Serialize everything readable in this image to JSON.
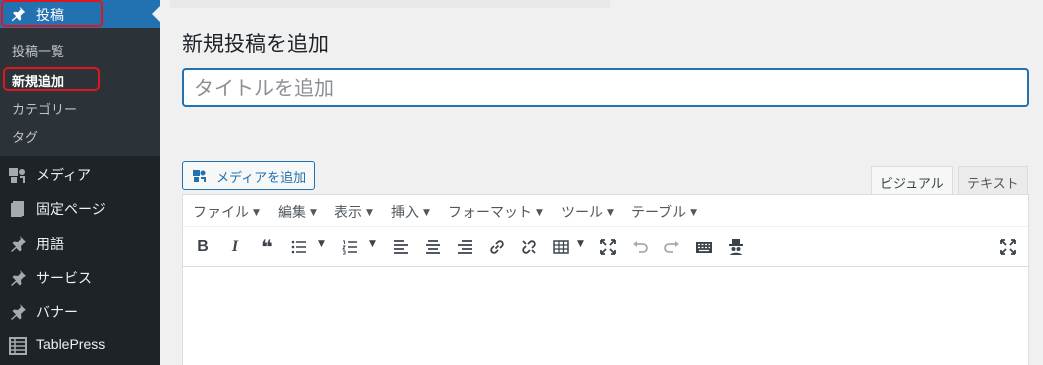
{
  "sidebar": {
    "top_item": "投稿",
    "submenu": [
      "投稿一覧",
      "新規追加",
      "カテゴリー",
      "タグ"
    ],
    "items": [
      "メディア",
      "固定ページ",
      "用語",
      "サービス",
      "バナー",
      "TablePress"
    ]
  },
  "main": {
    "page_title": "新規投稿を追加",
    "title_placeholder": "タイトルを追加",
    "media_button": "メディアを追加",
    "tabs": [
      "ビジュアル",
      "テキスト"
    ],
    "menubar": [
      "ファイル",
      "編集",
      "表示",
      "挿入",
      "フォーマット",
      "ツール",
      "テーブル"
    ]
  },
  "colors": {
    "sidebar_bg": "#1d2327",
    "submenu_bg": "#2c3338",
    "accent": "#2271b1",
    "highlight": "#e0161f"
  },
  "icons": {
    "top_item": "pushpin-icon",
    "items": [
      "media-icon",
      "page-icon",
      "pushpin-icon",
      "pushpin-icon",
      "pushpin-icon",
      "table-icon"
    ],
    "toolbar": [
      "bold-icon",
      "italic-icon",
      "blockquote-icon",
      "bullet-list-icon",
      "numbered-list-icon",
      "align-left-icon",
      "align-center-icon",
      "align-right-icon",
      "link-icon",
      "unlink-icon",
      "table-icon",
      "fullscreen-icon",
      "undo-icon",
      "redo-icon",
      "keyboard-icon",
      "spy-icon",
      "distraction-free-icon"
    ]
  }
}
